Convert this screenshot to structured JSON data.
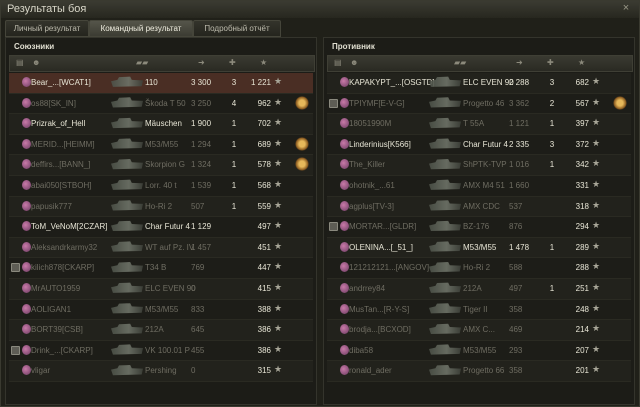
{
  "window": {
    "title": "Результаты боя",
    "close_glyph": "×"
  },
  "tabs": [
    {
      "label": "Личный результат",
      "active": false
    },
    {
      "label": "Командный результат",
      "active": true
    },
    {
      "label": "Подробный отчёт",
      "active": false
    }
  ],
  "allies": {
    "title": "Союзники",
    "rows": [
      {
        "name": "Bear_...[WCAT1]",
        "tank": "110",
        "damage": "3 300",
        "kills": "3",
        "xp": "1 221",
        "badge": false,
        "medal": false,
        "highlight": true,
        "dim": false
      },
      {
        "name": "os88[SK_IN]",
        "tank": "Škoda T 50",
        "damage": "3 250",
        "kills": "4",
        "xp": "962",
        "badge": false,
        "medal": true,
        "highlight": false,
        "dim": true
      },
      {
        "name": "Prizrak_of_Hell",
        "tank": "Mäuschen",
        "damage": "1 900",
        "kills": "1",
        "xp": "702",
        "badge": false,
        "medal": false,
        "highlight": false,
        "dim": false
      },
      {
        "name": "MERID...[HEIMM]",
        "tank": "M53/M55",
        "damage": "1 294",
        "kills": "1",
        "xp": "689",
        "badge": false,
        "medal": true,
        "highlight": false,
        "dim": true
      },
      {
        "name": "deffirs...[BANN_]",
        "tank": "Skorpion G",
        "damage": "1 324",
        "kills": "1",
        "xp": "578",
        "badge": false,
        "medal": true,
        "highlight": false,
        "dim": true
      },
      {
        "name": "abai050[STBOH]",
        "tank": "Lorr. 40 t",
        "damage": "1 539",
        "kills": "1",
        "xp": "568",
        "badge": false,
        "medal": false,
        "highlight": false,
        "dim": true
      },
      {
        "name": "papusik777",
        "tank": "Ho-Ri 2",
        "damage": "507",
        "kills": "1",
        "xp": "559",
        "badge": false,
        "medal": false,
        "highlight": false,
        "dim": true
      },
      {
        "name": "ToM_VeNoM[2CZAR]",
        "tank": "Char Futur 4",
        "damage": "1 129",
        "kills": "",
        "xp": "497",
        "badge": false,
        "medal": false,
        "highlight": false,
        "dim": false
      },
      {
        "name": "Aleksandrkarmy32",
        "tank": "WT auf Pz. IV",
        "damage": "1 457",
        "kills": "",
        "xp": "451",
        "badge": false,
        "medal": false,
        "highlight": false,
        "dim": true
      },
      {
        "name": "kilich878[CKARP]",
        "tank": "T34 B",
        "damage": "769",
        "kills": "",
        "xp": "447",
        "badge": true,
        "medal": false,
        "highlight": false,
        "dim": true
      },
      {
        "name": "MrAUTO1959",
        "tank": "ELC EVEN 90",
        "damage": "0",
        "kills": "",
        "xp": "415",
        "badge": false,
        "medal": false,
        "highlight": false,
        "dim": true
      },
      {
        "name": "AOLIGAN1",
        "tank": "M53/M55",
        "damage": "833",
        "kills": "",
        "xp": "388",
        "badge": false,
        "medal": false,
        "highlight": false,
        "dim": true
      },
      {
        "name": "BORT39[CSB]",
        "tank": "212A",
        "damage": "645",
        "kills": "",
        "xp": "386",
        "badge": false,
        "medal": false,
        "highlight": false,
        "dim": true
      },
      {
        "name": "Drink_...[CKARP]",
        "tank": "VK 100.01 P",
        "damage": "455",
        "kills": "",
        "xp": "386",
        "badge": true,
        "medal": false,
        "highlight": false,
        "dim": true
      },
      {
        "name": "vligar",
        "tank": "Pershing",
        "damage": "0",
        "kills": "",
        "xp": "315",
        "badge": false,
        "medal": false,
        "highlight": false,
        "dim": true
      }
    ]
  },
  "enemies": {
    "title": "Противник",
    "rows": [
      {
        "name": "KAPAKYPT_...[OSGTD]",
        "tank": "ELC EVEN 90",
        "damage": "2 288",
        "kills": "3",
        "xp": "682",
        "badge": false,
        "medal": false,
        "dim": false
      },
      {
        "name": "TPIYMF[E-V-G]",
        "tank": "Progetto 46",
        "damage": "3 362",
        "kills": "2",
        "xp": "567",
        "badge": true,
        "medal": true,
        "dim": true
      },
      {
        "name": "18051990M",
        "tank": "T 55A",
        "damage": "1 121",
        "kills": "1",
        "xp": "397",
        "badge": false,
        "medal": false,
        "dim": true
      },
      {
        "name": "Linderinius[K566]",
        "tank": "Char Futur 4",
        "damage": "2 335",
        "kills": "3",
        "xp": "372",
        "badge": false,
        "medal": false,
        "dim": false
      },
      {
        "name": "The_Killer",
        "tank": "ShPTK-TVP",
        "damage": "1 016",
        "kills": "1",
        "xp": "342",
        "badge": false,
        "medal": false,
        "dim": true
      },
      {
        "name": "ohotnik_...61",
        "tank": "AMX M4 51",
        "damage": "1 660",
        "kills": "",
        "xp": "331",
        "badge": false,
        "medal": false,
        "dim": true
      },
      {
        "name": "agplus[TV-3]",
        "tank": "AMX CDC",
        "damage": "537",
        "kills": "",
        "xp": "318",
        "badge": false,
        "medal": false,
        "dim": true
      },
      {
        "name": "MORTAR...[GLDR]",
        "tank": "BZ-176",
        "damage": "876",
        "kills": "",
        "xp": "294",
        "badge": true,
        "medal": false,
        "dim": true
      },
      {
        "name": "OLENINA...[_51_]",
        "tank": "M53/M55",
        "damage": "1 478",
        "kills": "1",
        "xp": "289",
        "badge": false,
        "medal": false,
        "dim": false
      },
      {
        "name": "121212121...[ANGOV]",
        "tank": "Ho-Ri 2",
        "damage": "588",
        "kills": "",
        "xp": "288",
        "badge": false,
        "medal": false,
        "dim": true
      },
      {
        "name": "andrrey84",
        "tank": "212A",
        "damage": "497",
        "kills": "1",
        "xp": "251",
        "badge": false,
        "medal": false,
        "dim": true
      },
      {
        "name": "MusTan...[R-Y-S]",
        "tank": "Tiger II",
        "damage": "358",
        "kills": "",
        "xp": "248",
        "badge": false,
        "medal": false,
        "dim": true
      },
      {
        "name": "brodja...[BCXOD]",
        "tank": "AMX C...",
        "damage": "469",
        "kills": "",
        "xp": "214",
        "badge": false,
        "medal": false,
        "dim": true
      },
      {
        "name": "diba58",
        "tank": "M53/M55",
        "damage": "293",
        "kills": "",
        "xp": "207",
        "badge": false,
        "medal": false,
        "dim": true
      },
      {
        "name": "ronald_ader",
        "tank": "Progetto 66",
        "damage": "358",
        "kills": "",
        "xp": "201",
        "badge": false,
        "medal": false,
        "dim": true
      }
    ]
  },
  "star_glyph": "★"
}
